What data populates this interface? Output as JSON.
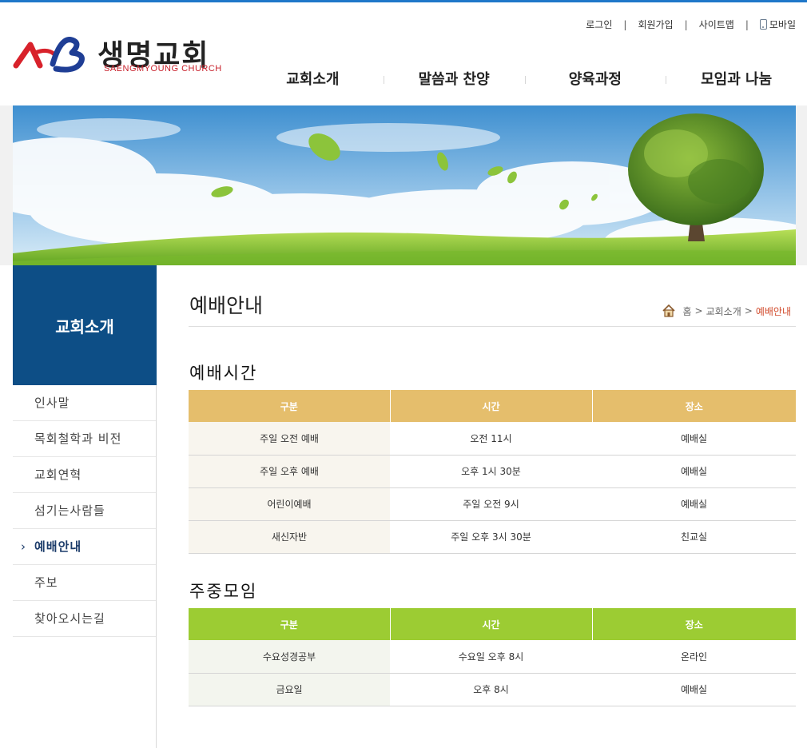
{
  "header": {
    "logo_text": "생명교회",
    "logo_sub": "SAENGMYOUNG CHURCH",
    "util": [
      "로그인",
      "회원가입",
      "사이트맵"
    ],
    "mobile": "모바일",
    "gnb": [
      "교회소개",
      "말씀과 찬양",
      "양육과정",
      "모임과 나눔"
    ]
  },
  "sidebar": {
    "title": "교회소개",
    "items": [
      "인사말",
      "목회철학과 비전",
      "교회연혁",
      "섬기는사람들",
      "예배안내",
      "주보",
      "찾아오시는길"
    ],
    "active_index": 4
  },
  "content": {
    "page_title": "예배안내",
    "breadcrumb": [
      "홈",
      "교회소개",
      "예배안내"
    ],
    "worship": {
      "title": "예배시간",
      "headers": [
        "구분",
        "시간",
        "장소"
      ],
      "rows": [
        [
          "주일 오전 예배",
          "오전 11시",
          "예배실"
        ],
        [
          "주일 오후 예배",
          "오후 1시 30분",
          "예배실"
        ],
        [
          "어린이예배",
          "주일 오전 9시",
          "예배실"
        ],
        [
          "새신자반",
          "주일 오후 3시 30분",
          "친교실"
        ]
      ]
    },
    "weekday": {
      "title": "주중모임",
      "headers": [
        "구분",
        "시간",
        "장소"
      ],
      "rows": [
        [
          "수요성경공부",
          "수요일 오후 8시",
          "온라인"
        ],
        [
          "금요일",
          "오후 8시",
          "예배실"
        ]
      ]
    }
  },
  "colors": {
    "brand_blue": "#0d4e86",
    "table1_header": "#e5be6c",
    "table2_header": "#9ccc33",
    "breadcrumb_active": "#d14a2b"
  }
}
